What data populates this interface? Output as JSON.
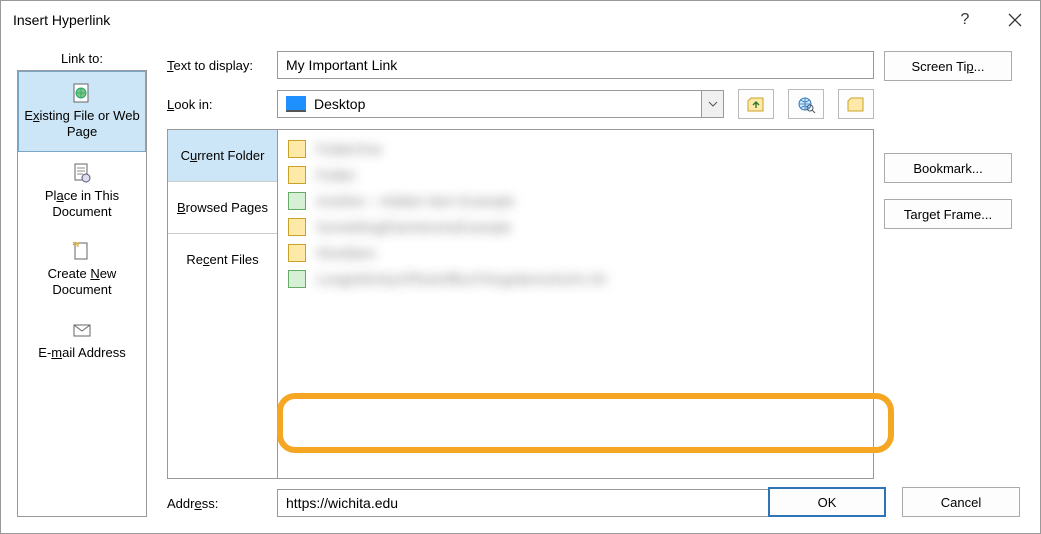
{
  "title": "Insert Hyperlink",
  "linkto": {
    "caption": "Link to:",
    "items": [
      {
        "label_pre": "E",
        "accel": "x",
        "label_post": "isting File or Web Page"
      },
      {
        "label_pre": "Pl",
        "accel": "a",
        "label_post": "ce in This Document"
      },
      {
        "label_pre": "Create ",
        "accel": "N",
        "label_post": "ew Document"
      },
      {
        "label_pre": "E-",
        "accel": "m",
        "label_post": "ail Address"
      }
    ]
  },
  "text_to_display": {
    "label_pre": "",
    "accel": "T",
    "label_post": "ext to display:",
    "value": "My Important Link"
  },
  "look_in": {
    "label_pre": "",
    "accel": "L",
    "label_post": "ook in:",
    "value": "Desktop"
  },
  "tabs": {
    "current": {
      "pre": "C",
      "accel": "u",
      "post": "rrent Folder"
    },
    "browsed": {
      "accel": "B",
      "post": "rowsed Pages"
    },
    "recent": {
      "pre": "Re",
      "accel": "c",
      "post": "ent Files"
    }
  },
  "files": [
    {
      "text": "FolderOne"
    },
    {
      "text": "Folder"
    },
    {
      "text": "Another – Hidden Item Example"
    },
    {
      "text": "SomethingElseHereAsExample"
    },
    {
      "text": "Shortitem"
    },
    {
      "text": "LongishEntryOfTextOfficeThingsItemsSoOn 00"
    }
  ],
  "address": {
    "label_pre": "Addr",
    "accel": "e",
    "label_post": "ss:",
    "value": "https://wichita.edu"
  },
  "buttons": {
    "screentip": {
      "pre": "Screen Ti",
      "accel": "p",
      "post": "..."
    },
    "bookmark": {
      "pre": "Bookmark",
      "accel": "",
      "post": "..."
    },
    "target_frame": {
      "pre": "Tar",
      "accel": "g",
      "post": "et Frame..."
    },
    "ok": "OK",
    "cancel": "Cancel"
  }
}
